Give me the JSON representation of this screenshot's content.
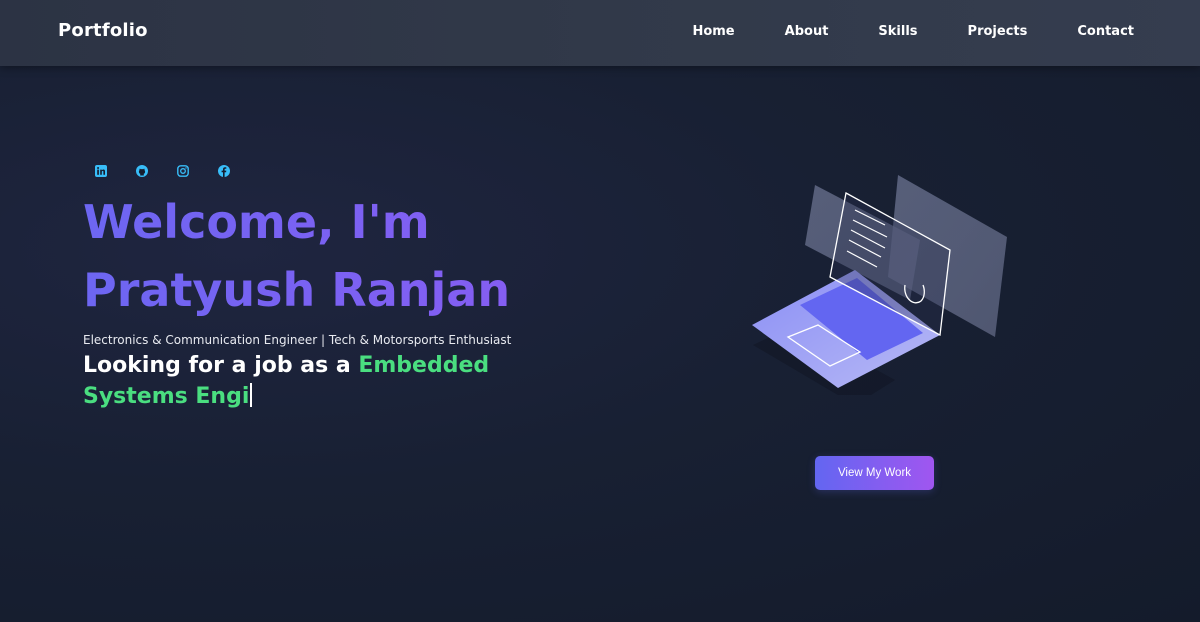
{
  "navbar": {
    "brand": "Portfolio",
    "links": [
      "Home",
      "About",
      "Skills",
      "Projects",
      "Contact"
    ]
  },
  "socials": [
    {
      "icon": "linkedin-icon"
    },
    {
      "icon": "github-icon"
    },
    {
      "icon": "instagram-icon"
    },
    {
      "icon": "facebook-icon"
    }
  ],
  "hero": {
    "title_line1": "Welcome, I'm",
    "title_line2": "Pratyush Ranjan",
    "subtitle": "Electronics & Communication Engineer | Tech & Motorsports Enthusiast",
    "typing_prefix": "Looking for a job as a ",
    "typing_role": "Embedded Systems Engi",
    "cta_label": "View My Work"
  },
  "colors": {
    "accent_start": "#6366f1",
    "accent_end": "#a056f0",
    "role_green": "#4ade80",
    "social_blue": "#38bdf8"
  },
  "illustration": {
    "icon": "laptop-illustration"
  }
}
